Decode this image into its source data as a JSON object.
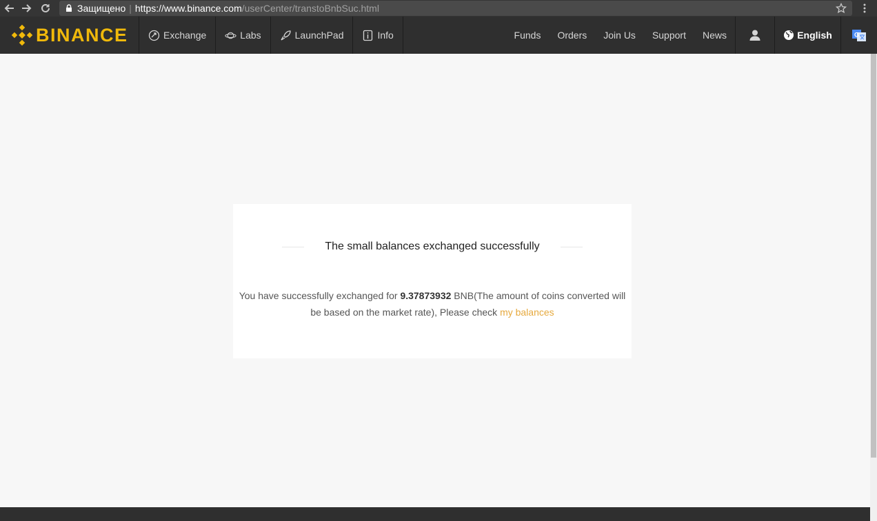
{
  "browser": {
    "secure_label": "Защищено",
    "url_host": "https://www.binance.com",
    "url_path": "/userCenter/transtoBnbSuc.html"
  },
  "header": {
    "logo_text": "BINANCE",
    "nav_left": [
      {
        "label": "Exchange",
        "icon": "exchange-icon"
      },
      {
        "label": "Labs",
        "icon": "planet-icon"
      },
      {
        "label": "LaunchPad",
        "icon": "rocket-icon"
      },
      {
        "label": "Info",
        "icon": "info-icon"
      }
    ],
    "nav_right": [
      "Funds",
      "Orders",
      "Join Us",
      "Support",
      "News"
    ],
    "user_icon": "user-icon",
    "language": "English",
    "translate_icon": "translate-icon"
  },
  "card": {
    "title": "The small balances exchanged successfully",
    "msg_prefix": "You have successfully exchanged for ",
    "amount": "9.37873932",
    "msg_suffix": " BNB(The amount of coins converted will be based on the market rate), Please check ",
    "link_text": "my balances"
  },
  "colors": {
    "brand": "#f0b90b",
    "link": "#e6a93e",
    "header_bg": "#2f2f2f",
    "page_bg": "#f7f7f7"
  }
}
